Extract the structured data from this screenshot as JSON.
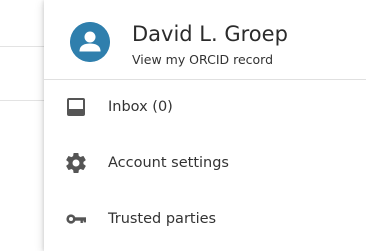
{
  "user": {
    "name": "David L. Groep",
    "orcid_link": "View my ORCID record",
    "avatar_icon": "person-icon",
    "avatar_color": "#2f7fad"
  },
  "menu": {
    "items": [
      {
        "label": "Inbox (0)",
        "icon": "inbox-icon"
      },
      {
        "label": "Account settings",
        "icon": "gear-icon"
      },
      {
        "label": "Trusted parties",
        "icon": "key-icon"
      }
    ]
  },
  "colors": {
    "icon": "#555555",
    "text": "#333333",
    "divider": "#e0e0e0"
  }
}
